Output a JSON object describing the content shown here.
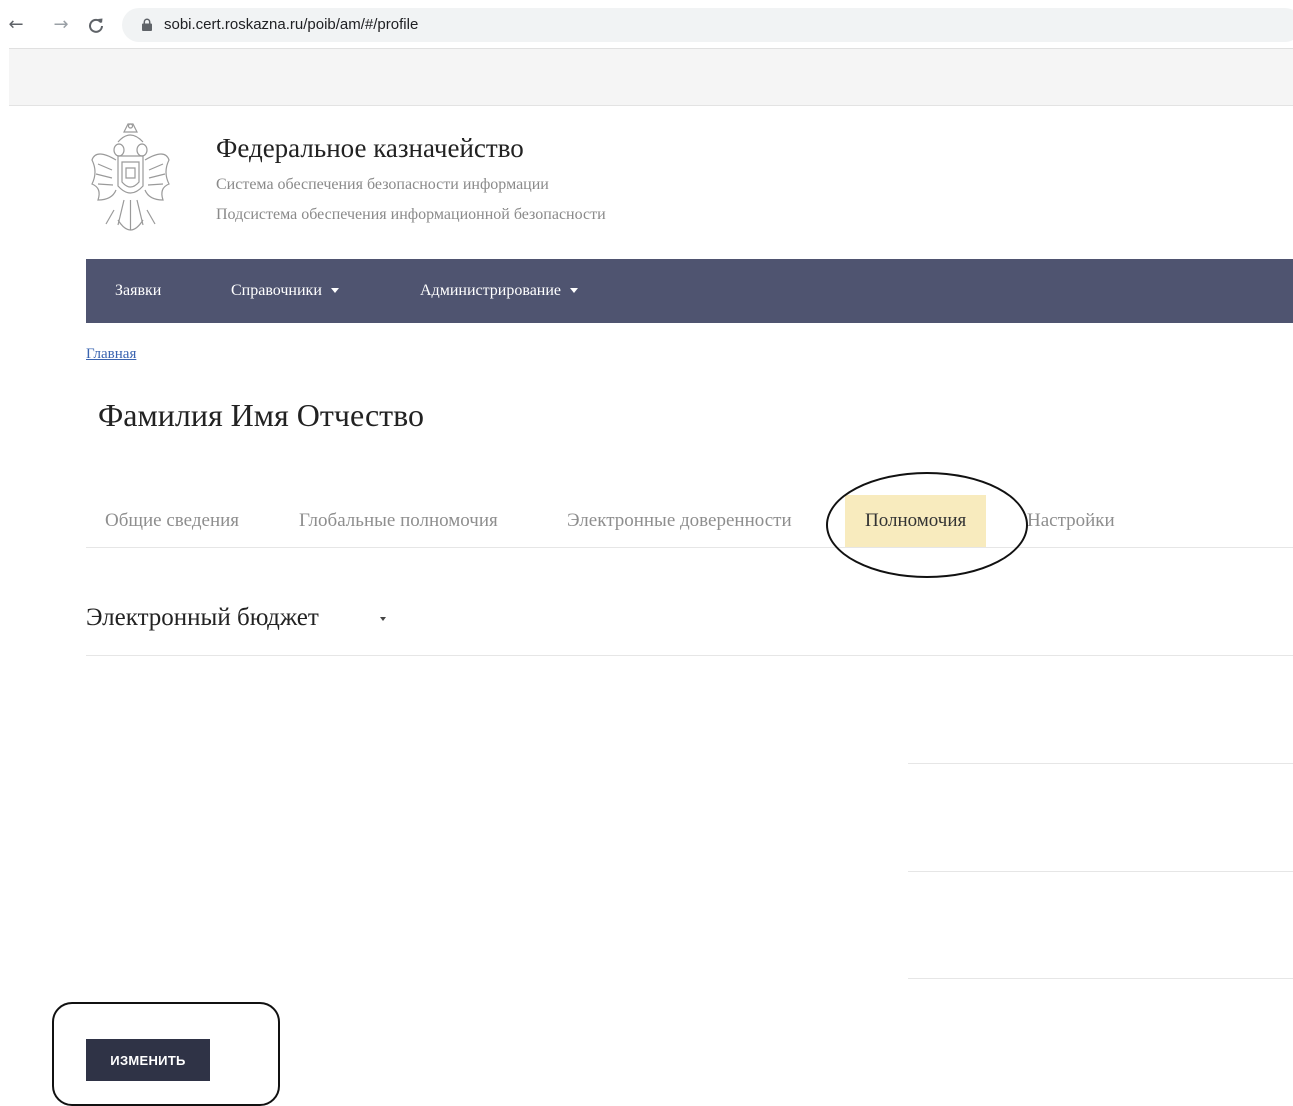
{
  "browser": {
    "url": "sobi.cert.roskazna.ru/poib/am/#/profile",
    "back_icon": "←",
    "forward_icon": "→",
    "reload_icon": "C"
  },
  "header": {
    "org_name": "Федеральное казначейство",
    "subtitle_1": "Система обеспечения безопасности информации",
    "subtitle_2": "Подсистема обеспечения информационной безопасности"
  },
  "main_nav": {
    "items": [
      {
        "label": "Заявки"
      },
      {
        "label": "Справочники"
      },
      {
        "label": "Администрирование"
      }
    ]
  },
  "breadcrumb": {
    "home": "Главная"
  },
  "profile": {
    "name": "Фамилия Имя Отчество"
  },
  "tabs": [
    {
      "label": "Общие сведения"
    },
    {
      "label": "Глобальные полномочия"
    },
    {
      "label": "Электронные доверенности"
    },
    {
      "label": "Полномочия",
      "active": true
    },
    {
      "label": "Настройки"
    }
  ],
  "section": {
    "title": "Электронный бюджет"
  },
  "actions": {
    "edit_label": "ИЗМЕНИТЬ"
  },
  "colors": {
    "nav_bg": "#4f5470",
    "active_tab_bg": "#f8ebbe",
    "button_bg": "#2f3346",
    "link": "#3a64b0"
  }
}
